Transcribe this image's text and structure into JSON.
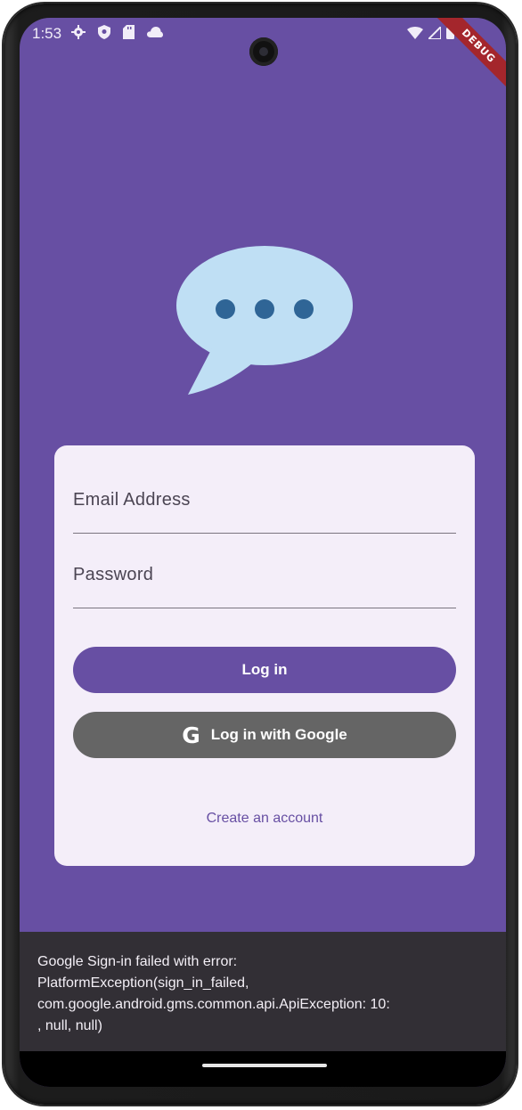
{
  "status_bar": {
    "time": "1:53",
    "left_icons": [
      "gear-icon",
      "shield-icon",
      "sd-card-icon",
      "cloud-icon"
    ],
    "right_icons": [
      "wifi-icon",
      "signal-icon",
      "battery-icon"
    ]
  },
  "debug_banner": "DEBUG",
  "colors": {
    "primary": "#674fa3",
    "card_background": "#f4eef9",
    "google_button": "#656565",
    "snackbar_background": "#322f35",
    "logo_bubble": "#bfdff4",
    "logo_dots": "#2f6596"
  },
  "logo": {
    "icon": "chat-bubble-icon"
  },
  "login_form": {
    "email_placeholder": "Email Address",
    "email_value": "",
    "password_placeholder": "Password",
    "password_value": "",
    "login_button_label": "Log in",
    "google_button_label": "Log in with Google",
    "google_icon_glyph": "G",
    "create_account_label": "Create an account"
  },
  "snackbar": {
    "lines": [
      "Google Sign-in failed with error:",
      "PlatformException(sign_in_failed,",
      "com.google.android.gms.common.api.ApiException: 10:",
      ", null, null)"
    ]
  }
}
